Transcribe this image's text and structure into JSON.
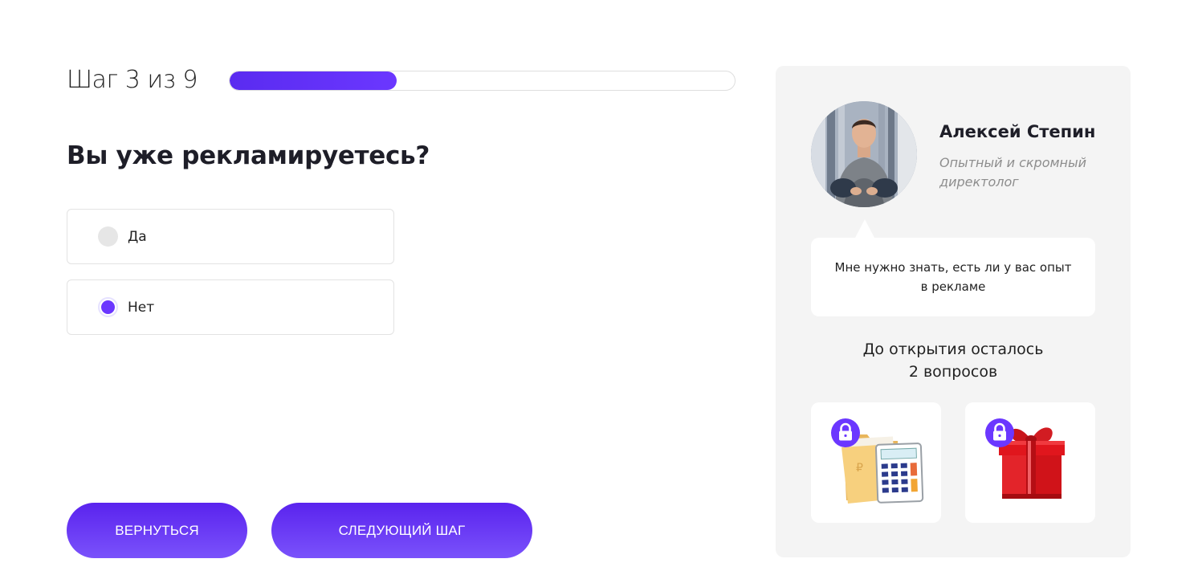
{
  "quiz": {
    "step_label": "Шаг 3 из 9",
    "progress_fraction": 0.33,
    "question": "Вы уже рекламируетесь?",
    "options": [
      {
        "label": "Да",
        "selected": false
      },
      {
        "label": "Нет",
        "selected": true
      }
    ],
    "back_label": "ВЕРНУТЬСЯ",
    "next_label": "СЛЕДУЮЩИЙ ШАГ"
  },
  "expert": {
    "name": "Алексей Степин",
    "role": "Опытный и скромный директолог",
    "message": "Мне нужно знать, есть ли у вас опыт в рекламе"
  },
  "bonus": {
    "remaining_line1": "До открытия осталось",
    "remaining_line2": "2 вопросов",
    "items": [
      {
        "icon": "calculator-folder-icon",
        "locked": true
      },
      {
        "icon": "gift-box-icon",
        "locked": true
      }
    ]
  },
  "colors": {
    "accent": "#6b37ff",
    "accent_dark": "#5a23ee",
    "panel_bg": "#f4f4f4",
    "radio_off": "#e6e6e6"
  }
}
